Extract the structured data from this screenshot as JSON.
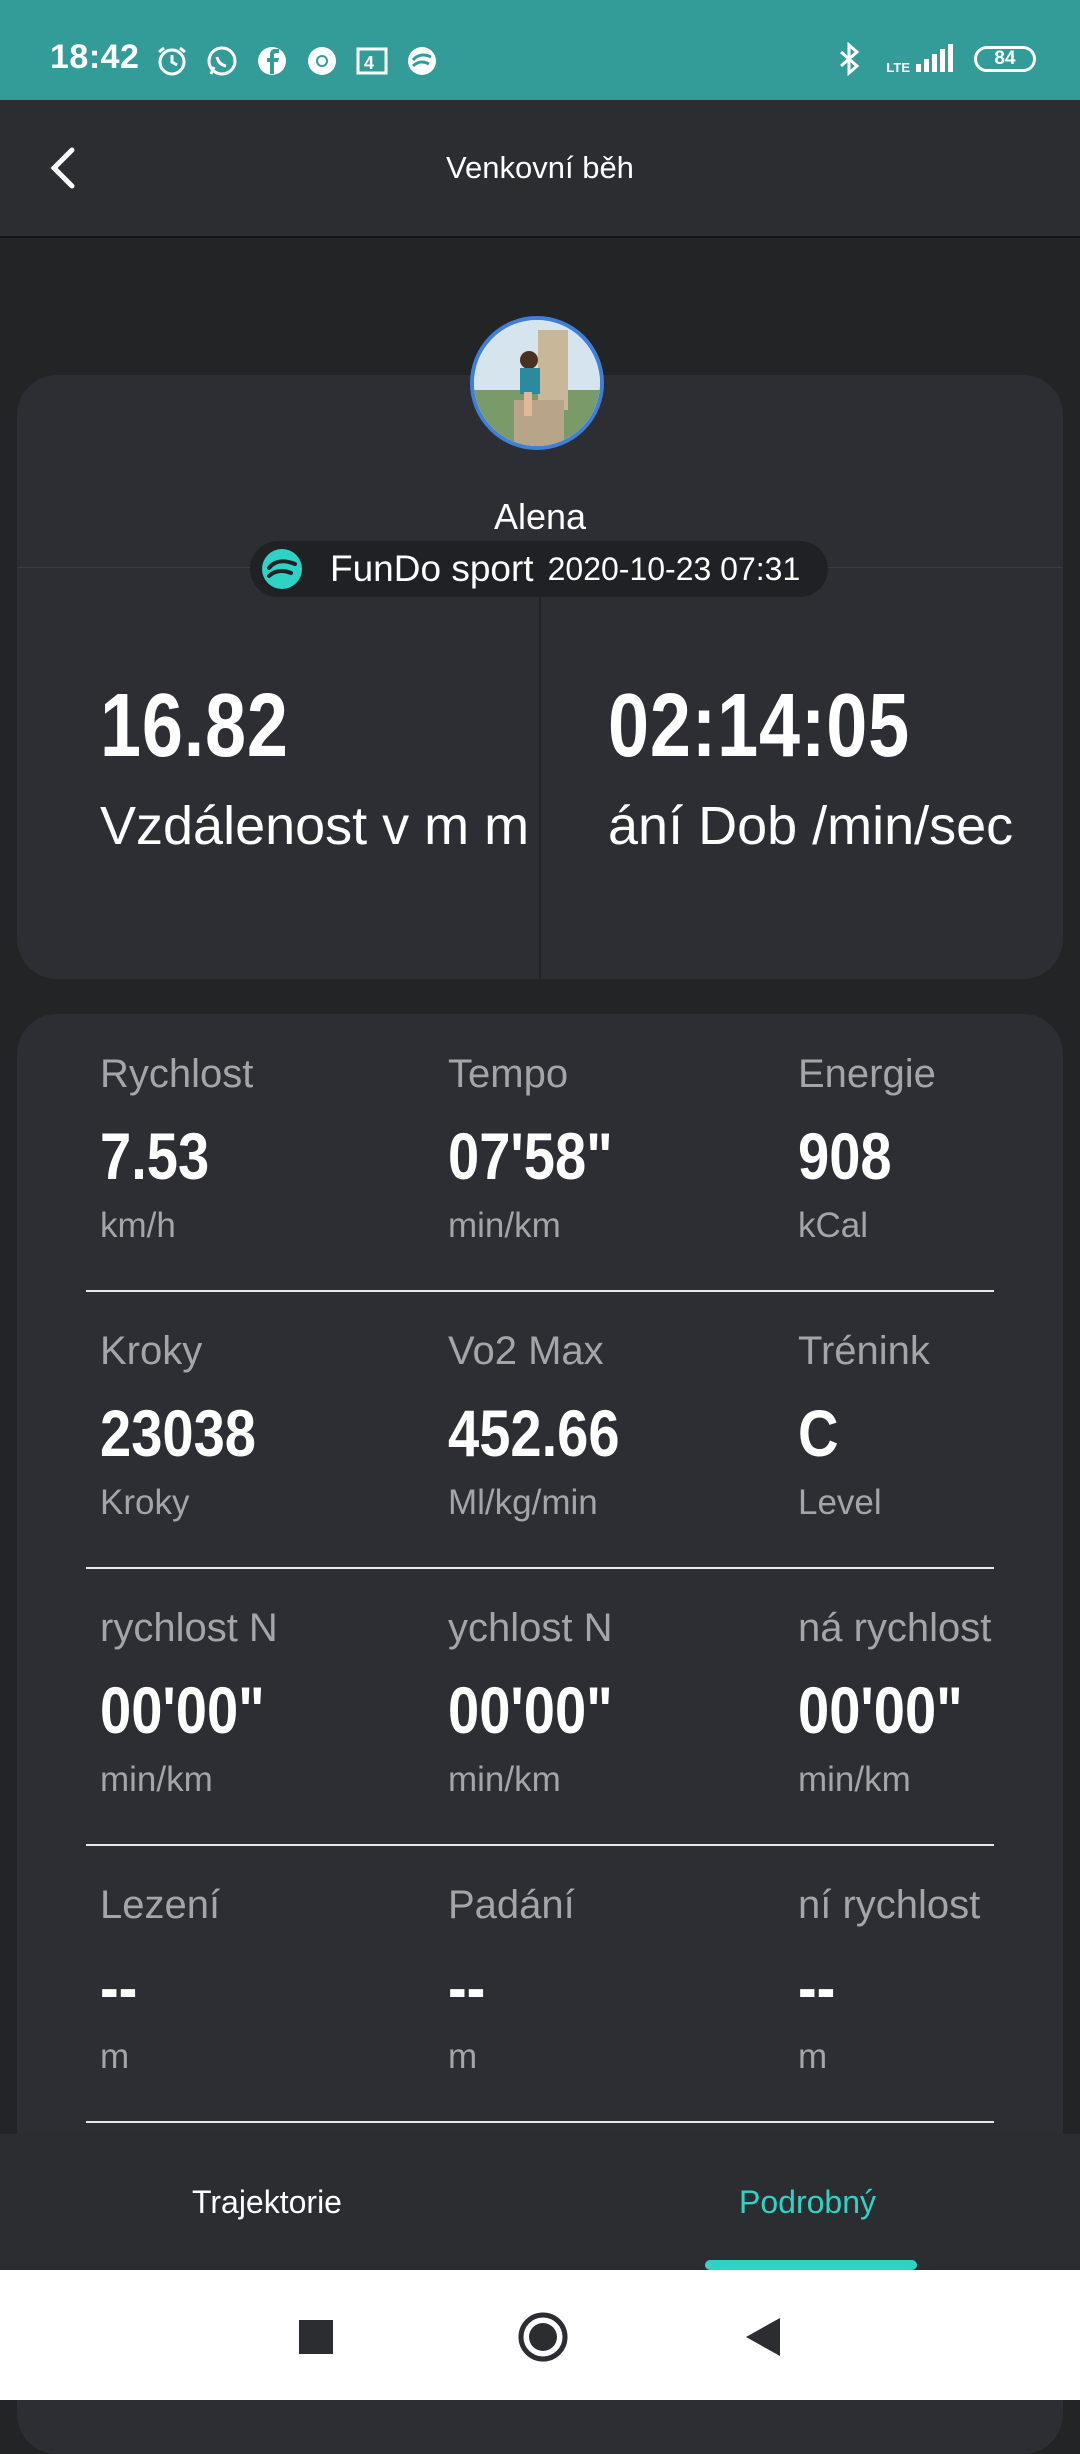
{
  "status_bar": {
    "time": "18:42",
    "network": "LTE",
    "battery": "84"
  },
  "header": {
    "title": "Venkovní běh"
  },
  "profile": {
    "name": "Alena",
    "app": "FunDo sport",
    "datetime": "2020-10-23 07:31"
  },
  "summary": {
    "distance_value": "16.82",
    "distance_label": "Vzdálenost v m   m",
    "duration_value": "02:14:05",
    "duration_label": "ání      Dob /min/sec"
  },
  "stats": [
    [
      {
        "label": "Rychlost",
        "value": "7.53",
        "unit": "km/h"
      },
      {
        "label": "Tempo",
        "value": "07'58\"",
        "unit": "min/km"
      },
      {
        "label": "Energie",
        "value": "908",
        "unit": "kCal"
      }
    ],
    [
      {
        "label": "Kroky",
        "value": "23038",
        "unit": "Kroky"
      },
      {
        "label": "Vo2 Max",
        "value": "452.66",
        "unit": "Ml/kg/min"
      },
      {
        "label": "Trénink",
        "value": "C",
        "unit": "Level"
      }
    ],
    [
      {
        "label": "rychlost     N",
        "value": "00'00\"",
        "unit": "min/km"
      },
      {
        "label": "ychlost     N",
        "value": "00'00\"",
        "unit": "min/km"
      },
      {
        "label": "ná rychlost",
        "value": "00'00\"",
        "unit": "min/km"
      }
    ],
    [
      {
        "label": "Lezení",
        "value": "--",
        "unit": "m"
      },
      {
        "label": "Padání",
        "value": "--",
        "unit": "m"
      },
      {
        "label": "ní rychlost",
        "value": "--",
        "unit": "m"
      }
    ]
  ],
  "tabs": [
    {
      "label": "Trajektorie",
      "active": false
    },
    {
      "label": "Podrobný",
      "active": true
    }
  ],
  "colors": {
    "accent": "#2fd3c5",
    "status_bar": "#339c98",
    "card": "#2c2e33",
    "background": "#222426"
  },
  "icons": [
    "alarm-icon",
    "whatsapp-icon",
    "facebook-icon",
    "chrome-icon",
    "4i-icon",
    "fundo-icon",
    "bluetooth-icon",
    "signal-icon",
    "back-arrow-icon",
    "recents-icon",
    "home-icon",
    "back-icon"
  ]
}
